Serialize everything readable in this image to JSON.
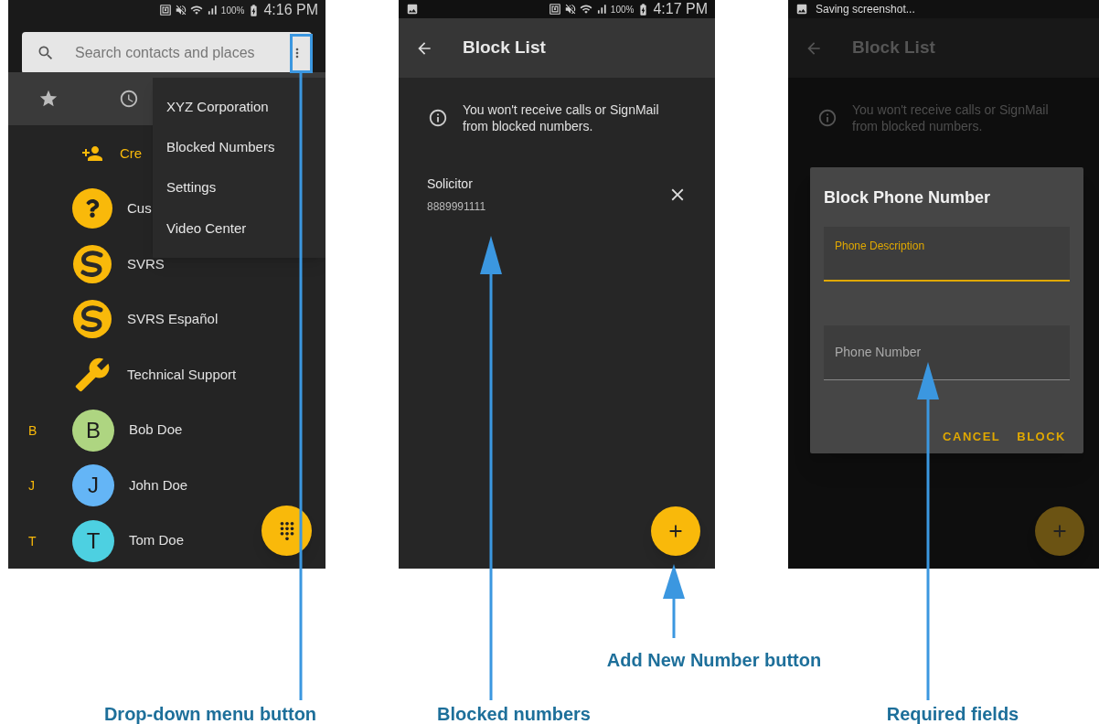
{
  "contacts_screen": {
    "status_bar": {
      "battery": "100%",
      "time": "4:16 PM"
    },
    "search": {
      "placeholder": "Search contacts and places"
    },
    "menu": [
      "XYZ Corporation",
      "Blocked Numbers",
      "Settings",
      "Video Center"
    ],
    "create_row": {
      "label": "Cre"
    },
    "contacts": [
      {
        "kind": "help",
        "name": "Cus"
      },
      {
        "kind": "logo",
        "name": "SVRS"
      },
      {
        "kind": "logo",
        "name": "SVRS Español"
      },
      {
        "kind": "wrench",
        "name": "Technical Support"
      },
      {
        "kind": "letter",
        "section": "B",
        "letter": "B",
        "color": "#aed581",
        "name": "Bob Doe"
      },
      {
        "kind": "letter",
        "section": "J",
        "letter": "J",
        "color": "#64b5f6",
        "name": "John Doe"
      },
      {
        "kind": "letter",
        "section": "T",
        "letter": "T",
        "color": "#4dd0e1",
        "name": "Tom Doe"
      }
    ]
  },
  "block_list_screen": {
    "status_bar": {
      "battery": "100%",
      "time": "4:17 PM"
    },
    "title": "Block List",
    "dimmed": false,
    "info": "You won't receive calls or SignMail from blocked numbers.",
    "blocked": [
      {
        "name": "Solicitor",
        "number": "8889991111"
      }
    ]
  },
  "dialog_screen": {
    "status_bar": {
      "notification": "Saving screenshot..."
    },
    "title": "Block List",
    "dimmed": true,
    "info": "You won't receive calls or SignMail from blocked numbers.",
    "dialog": {
      "title": "Block Phone Number",
      "fields": [
        {
          "label": "Phone Description",
          "focused": true
        },
        {
          "label": "Phone Number",
          "focused": false
        }
      ],
      "buttons": [
        "CANCEL",
        "BLOCK"
      ]
    }
  },
  "callouts": [
    "Drop-down menu button",
    "Blocked numbers",
    "Add New Number button",
    "Required fields"
  ]
}
